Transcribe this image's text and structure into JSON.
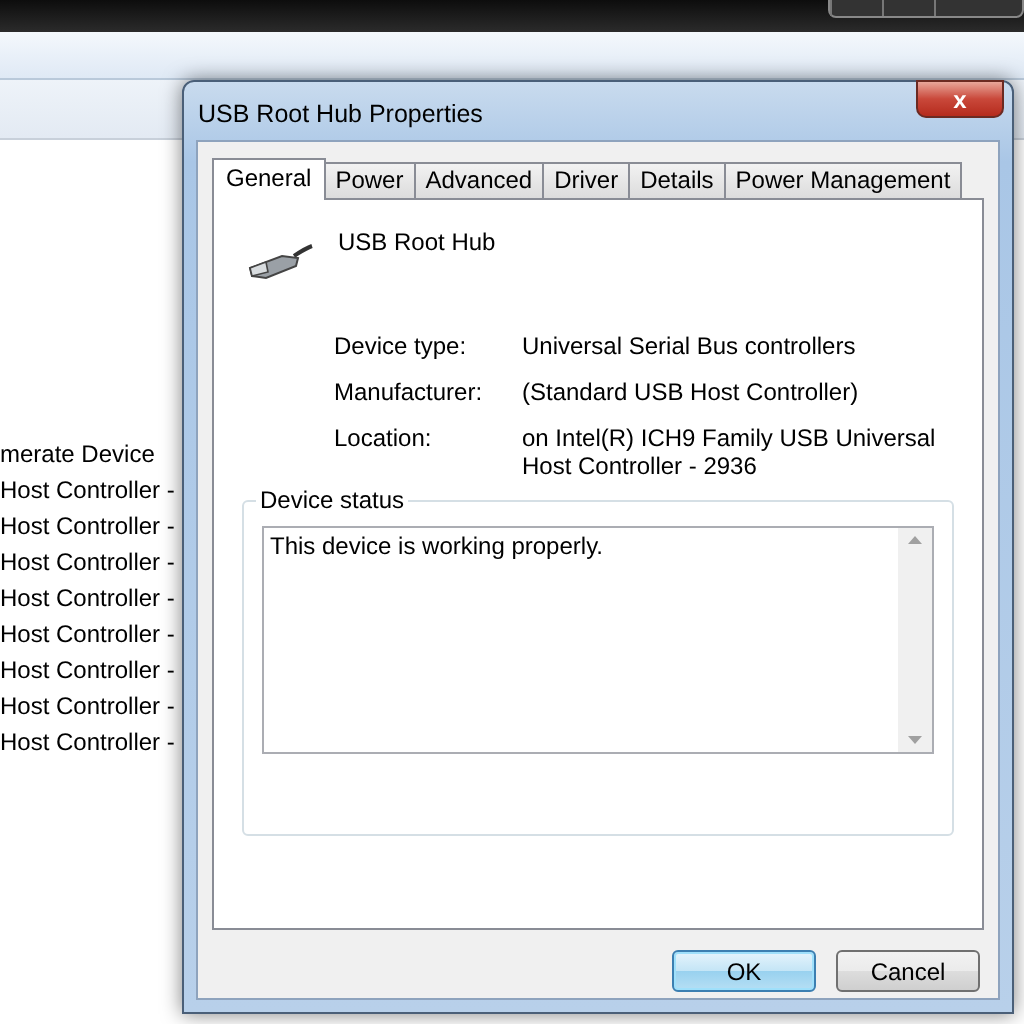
{
  "background_window": {
    "list_items": [
      "merate Device",
      "Host Controller -",
      "Host Controller -",
      "Host Controller -",
      "Host Controller -",
      "Host Controller -",
      "Host Controller -",
      "Host Controller -",
      "Host Controller -"
    ]
  },
  "dialog": {
    "title": "USB Root Hub Properties",
    "close_label": "x",
    "tabs": [
      {
        "label": "General",
        "selected": true
      },
      {
        "label": "Power",
        "selected": false
      },
      {
        "label": "Advanced",
        "selected": false
      },
      {
        "label": "Driver",
        "selected": false
      },
      {
        "label": "Details",
        "selected": false
      },
      {
        "label": "Power Management",
        "selected": false
      }
    ],
    "device_name": "USB Root Hub",
    "properties": [
      {
        "label": "Device type:",
        "value": "Universal Serial Bus controllers"
      },
      {
        "label": "Manufacturer:",
        "value": "(Standard USB Host Controller)"
      },
      {
        "label": "Location:",
        "value": "on Intel(R) ICH9 Family USB Universal Host Controller - 2936"
      }
    ],
    "device_status": {
      "legend": "Device status",
      "text": "This device is working properly."
    },
    "buttons": [
      {
        "label": "OK",
        "default": true
      },
      {
        "label": "Cancel",
        "default": false
      }
    ]
  }
}
